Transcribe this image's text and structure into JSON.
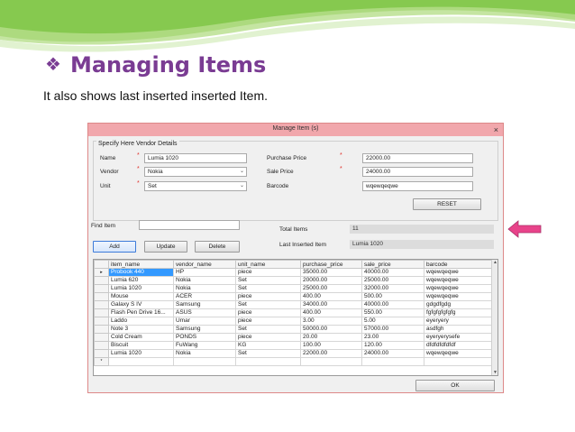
{
  "slide": {
    "title": "Managing Items",
    "subtitle": "It also shows last inserted inserted Item."
  },
  "window": {
    "title": "Manage Item (s)",
    "close": "×",
    "group_title": "Specify Here Vendor Details",
    "fields": {
      "name_label": "Name",
      "name_value": "Lumia 1020",
      "vendor_label": "Vendor",
      "vendor_value": "Nokia",
      "unit_label": "Unit",
      "unit_value": "Set",
      "purchase_price_label": "Purchase Price",
      "purchase_price_value": "22000.00",
      "sale_price_label": "Sale Price",
      "sale_price_value": "24000.00",
      "barcode_label": "Barcode",
      "barcode_value": "wqewqeqwe",
      "required_mark": "*"
    },
    "reset_label": "RESET",
    "find_item_label": "Find Item",
    "find_item_value": "",
    "total_items_label": "Total Items",
    "total_items_value": "11",
    "last_inserted_label": "Last Inserted Item",
    "last_inserted_value": "Lumia 1020",
    "add_label": "Add",
    "update_label": "Update",
    "delete_label": "Delete",
    "ok_label": "OK",
    "grid": {
      "columns": [
        "item_name",
        "vendor_name",
        "unit_name",
        "purchase_price",
        "sale_price",
        "barcode"
      ],
      "rows": [
        [
          "Probook 440",
          "HP",
          "piece",
          "35000.00",
          "40000.00",
          "wqewqeqwe"
        ],
        [
          "Lumia 620",
          "Nokia",
          "Set",
          "20000.00",
          "25000.00",
          "wqewqeqwe"
        ],
        [
          "Lumia 1020",
          "Nokia",
          "Set",
          "25000.00",
          "32000.00",
          "wqewqeqwe"
        ],
        [
          "Mouse",
          "ACER",
          "piece",
          "400.00",
          "500.00",
          "wqewqeqwe"
        ],
        [
          "Galaxy S IV",
          "Samsung",
          "Set",
          "34000.00",
          "40000.00",
          "gdgdfgdg"
        ],
        [
          "Flash Pen Drive 16...",
          "ASUS",
          "piece",
          "400.00",
          "550.00",
          "fgfgfgfgfgfg"
        ],
        [
          "Laddo",
          "Umar",
          "piece",
          "3.00",
          "5.00",
          "eyeryery"
        ],
        [
          "Note 3",
          "Samsung",
          "Set",
          "50000.00",
          "57000.00",
          "asdfgh"
        ],
        [
          "Cold Cream",
          "PONDS",
          "piece",
          "20.00",
          "23.00",
          "eyeryerysefe"
        ],
        [
          "Biscuit",
          "FuWang",
          "KG",
          "100.00",
          "120.00",
          "dfdfdfdfdfdf"
        ],
        [
          "Lumia 1020",
          "Nokia",
          "Set",
          "22000.00",
          "24000.00",
          "wqewqeqwe"
        ]
      ],
      "current_row_marker": "▸",
      "new_row_marker": "*"
    }
  },
  "colors": {
    "accent_purple": "#7a3c93",
    "banner_green": "#7cc24a",
    "titlebar_pink": "#f1a7ac",
    "arrow_pink": "#e8438a",
    "selection_blue": "#3399ff"
  }
}
